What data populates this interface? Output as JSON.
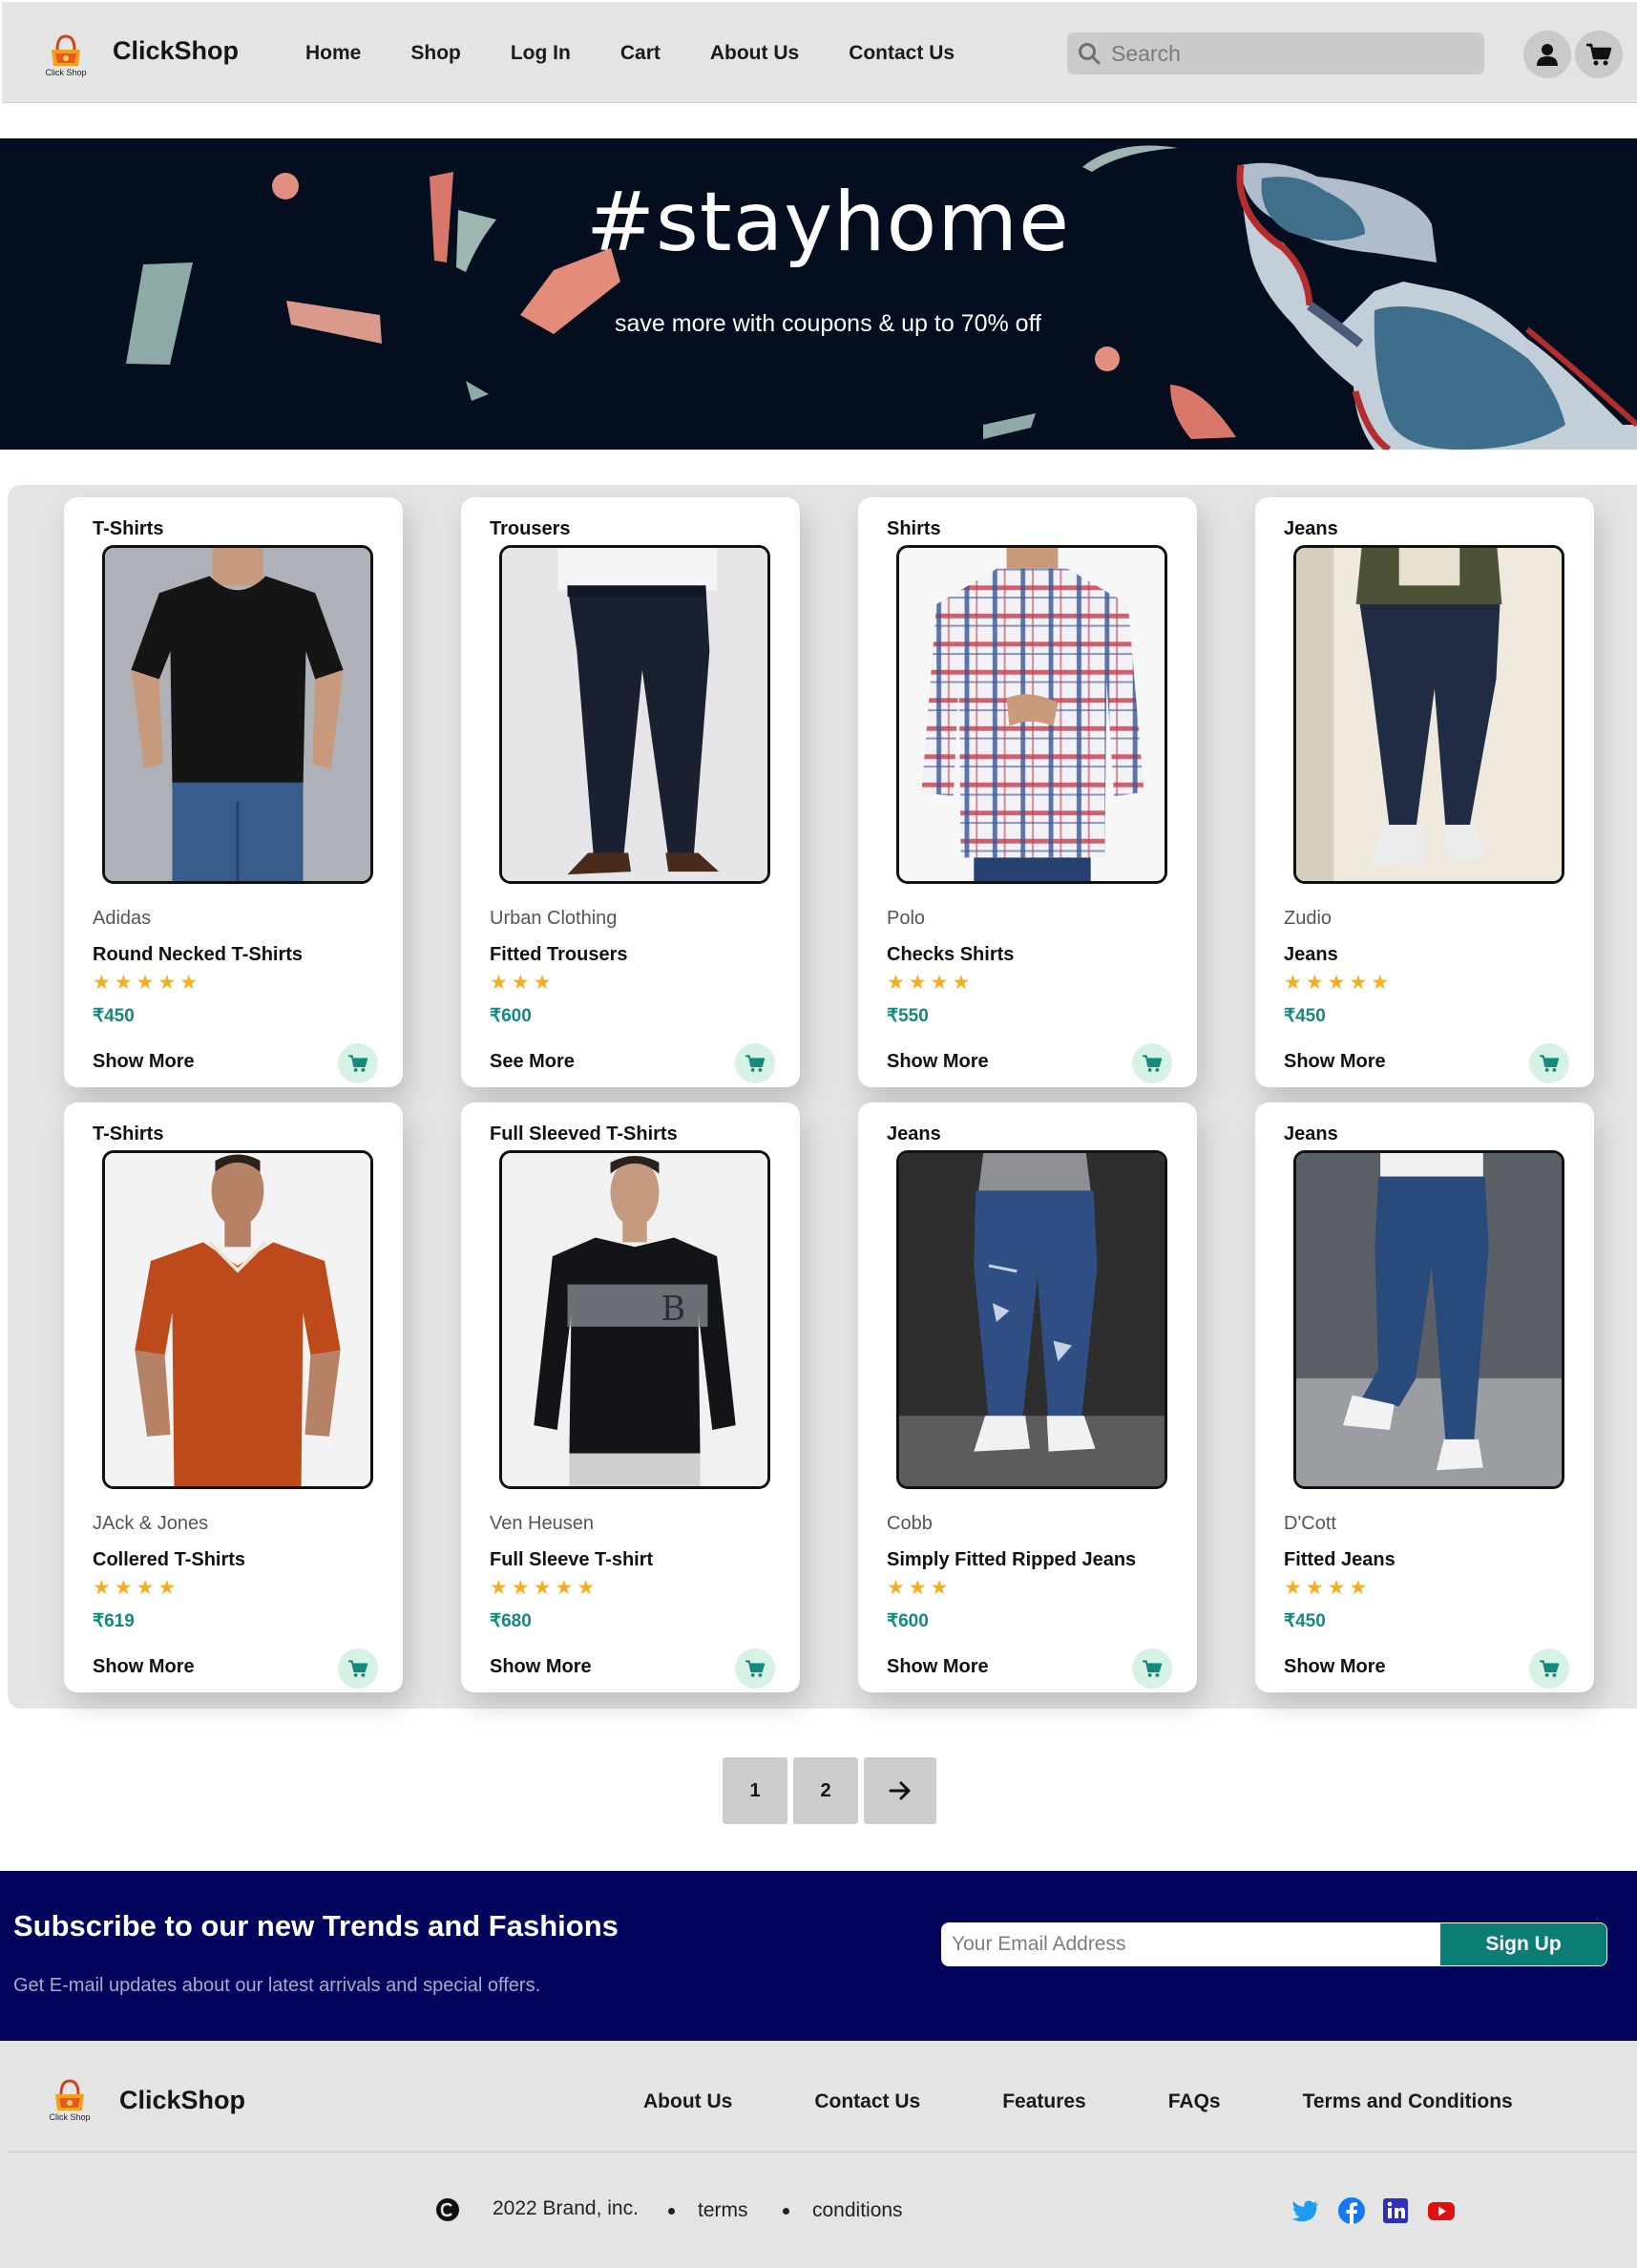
{
  "header": {
    "brand": "ClickShop",
    "logo_caption": "Click Shop",
    "nav": [
      "Home",
      "Shop",
      "Log In",
      "Cart",
      "About Us",
      "Contact Us"
    ],
    "search_placeholder": "Search"
  },
  "hero": {
    "title": "#stayhome",
    "subtitle": "save more with coupons & up to 70% off"
  },
  "products": [
    {
      "category": "T-Shirts",
      "brand": "Adidas",
      "name": "Round Necked T-Shirts",
      "stars": 5,
      "stars_text": "★★★★★",
      "price": "₹450",
      "action": "Show More"
    },
    {
      "category": "Trousers",
      "brand": "Urban Clothing",
      "name": "Fitted Trousers",
      "stars": 3,
      "stars_text": "★★★",
      "price": "₹600",
      "action": "See More"
    },
    {
      "category": "Shirts",
      "brand": "Polo",
      "name": "Checks Shirts",
      "stars": 4,
      "stars_text": "★★★★",
      "price": "₹550",
      "action": "Show More"
    },
    {
      "category": "Jeans",
      "brand": "Zudio",
      "name": "Jeans",
      "stars": 5,
      "stars_text": "★★★★★",
      "price": "₹450",
      "action": "Show More"
    },
    {
      "category": "T-Shirts",
      "brand": "JAck & Jones",
      "name": "Collered T-Shirts",
      "stars": 4,
      "stars_text": "★★★★",
      "price": "₹619",
      "action": "Show More"
    },
    {
      "category": "Full Sleeved T-Shirts",
      "brand": "Ven Heusen",
      "name": "Full Sleeve T-shirt",
      "stars": 5,
      "stars_text": "★★★★★",
      "price": "₹680",
      "action": "Show More"
    },
    {
      "category": "Jeans",
      "brand": "Cobb",
      "name": "Simply Fitted Ripped Jeans",
      "stars": 3,
      "stars_text": "★★★",
      "price": "₹600",
      "action": "Show More"
    },
    {
      "category": "Jeans",
      "brand": "D'Cott",
      "name": "Fitted Jeans",
      "stars": 4,
      "stars_text": "★★★★",
      "price": "₹450",
      "action": "Show More"
    }
  ],
  "pagination": {
    "pages": [
      "1",
      "2"
    ],
    "next": "→"
  },
  "newsletter": {
    "title": "Subscribe to our new Trends and Fashions",
    "subtitle": "Get E-mail updates about our latest arrivals and special offers.",
    "email_placeholder": "Your Email Address",
    "button": "Sign Up"
  },
  "footer": {
    "brand": "ClickShop",
    "links": [
      "About Us",
      "Contact Us",
      "Features",
      "FAQs",
      "Terms and Conditions"
    ],
    "copyright": "2022 Brand, inc.",
    "terms": "terms",
    "conditions": "conditions",
    "social_icons": [
      "twitter-icon",
      "facebook-icon",
      "linkedin-icon",
      "youtube-icon"
    ]
  },
  "colors": {
    "header_bg": "#e2e5e4",
    "hero_bg": "#050e1e",
    "price": "#128a7d",
    "star": "#f4ae1e",
    "newsletter_bg": "#03045b",
    "signup_btn": "#0b7d75",
    "cart_btn_bg": "#d6f2e4"
  }
}
